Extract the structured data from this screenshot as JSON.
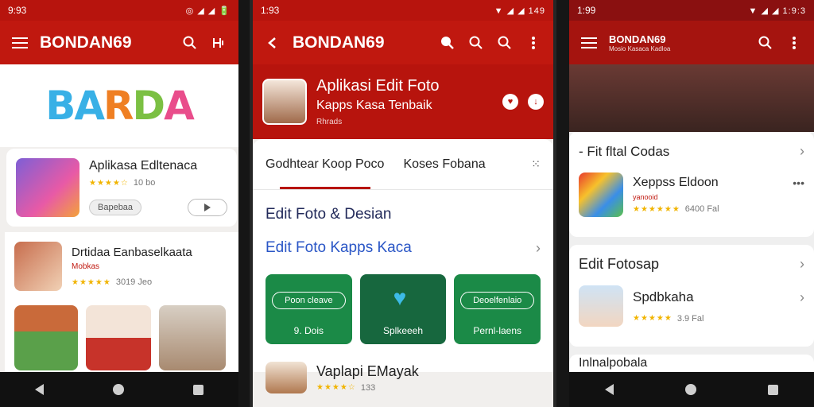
{
  "phone1": {
    "status": {
      "time": "9:93",
      "icons": "◎ ◢ ◢ 🔋"
    },
    "appbar": {
      "title": "BONDAN69"
    },
    "banner": {
      "word_parts": [
        "BA",
        "R",
        "D",
        "A"
      ]
    },
    "featured": {
      "title": "Aplikasa Edltenaca",
      "rating": "★★★★☆",
      "meta": "10 bo",
      "action": "Bapebaa"
    },
    "list": {
      "title": "Drtidaa Eanbaselkaata",
      "subtitle": "Mobkas",
      "rating": "★★★★★",
      "meta": "3019 Jeo"
    }
  },
  "phone2": {
    "status": {
      "time": "1:93",
      "icons": "▼ ◢ ◢ 149"
    },
    "appbar": {
      "title": "BONDAN69"
    },
    "hero": {
      "title": "Aplikasi Edit Foto",
      "subtitle": "Kapps Kasa Tenbaik",
      "meta": "Rhrads"
    },
    "tabs": [
      {
        "label": "Godhtear Koop Poco"
      },
      {
        "label": "Koses Fobana"
      }
    ],
    "section_title": "Edit Foto & Desian",
    "link_row": "Edit Foto Kapps Kaca",
    "tiles": [
      {
        "pill": "Poon cleave",
        "caption": "9. Dois"
      },
      {
        "pill": "",
        "caption": "Splkeeeh"
      },
      {
        "pill": "Deoelfenlaio",
        "caption": "Pernl-laens"
      }
    ],
    "bottom_item": {
      "title": "Vaplapi EMayak",
      "rating": "★★★★☆",
      "meta": "133"
    }
  },
  "phone3": {
    "status": {
      "time": "1:99",
      "icons": "▼ ◢ ◢ 1:9:3"
    },
    "appbar": {
      "title": "BONDAN69",
      "subtitle": "Mosio Kasaca Kadloa"
    },
    "section1": {
      "title": "- Fit fltal Codas",
      "item_title": "Xeppss Eldoon",
      "item_meta": "yanooid",
      "rating": "★★★★★★",
      "count": "6400 Fal"
    },
    "section2": {
      "title": "Edit Fotosap",
      "item_title": "Spdbkaha",
      "rating": "★★★★★",
      "count": "3.9 Fal"
    },
    "section3": {
      "title": "Inlnalpobala"
    }
  },
  "colors": {
    "brand_red": "#c0180f",
    "status_red": "#b7140d",
    "tile_green": "#1b8a47",
    "star_yellow": "#f1b400"
  }
}
